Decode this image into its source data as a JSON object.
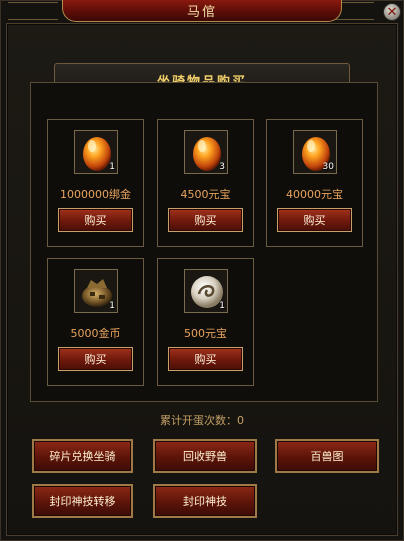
{
  "window": {
    "title": "马倌",
    "close_symbol": "✕"
  },
  "section": {
    "title": "坐骑物品购买"
  },
  "items": [
    {
      "icon": "orange-egg-icon",
      "qty": "1",
      "price": "1000000绑金",
      "buy": "购买"
    },
    {
      "icon": "orange-egg-icon",
      "qty": "3",
      "price": "4500元宝",
      "buy": "购买"
    },
    {
      "icon": "orange-egg-icon",
      "qty": "30",
      "price": "40000元宝",
      "buy": "购买"
    },
    {
      "icon": "fragment-pouch-icon",
      "qty": "1",
      "price": "5000金币",
      "buy": "购买"
    },
    {
      "icon": "white-orb-icon",
      "qty": "1",
      "price": "500元宝",
      "buy": "购买"
    }
  ],
  "counter": "累计开蛋次数：0",
  "actions": [
    {
      "label": "碎片兑换坐骑"
    },
    {
      "label": "回收野兽"
    },
    {
      "label": "百兽图"
    },
    {
      "label": "封印神技转移"
    },
    {
      "label": "封印神技"
    }
  ],
  "colors": {
    "accent_gold": "#f0cf6b",
    "price_orange": "#e7a35e",
    "button_red": "#6e180b"
  }
}
